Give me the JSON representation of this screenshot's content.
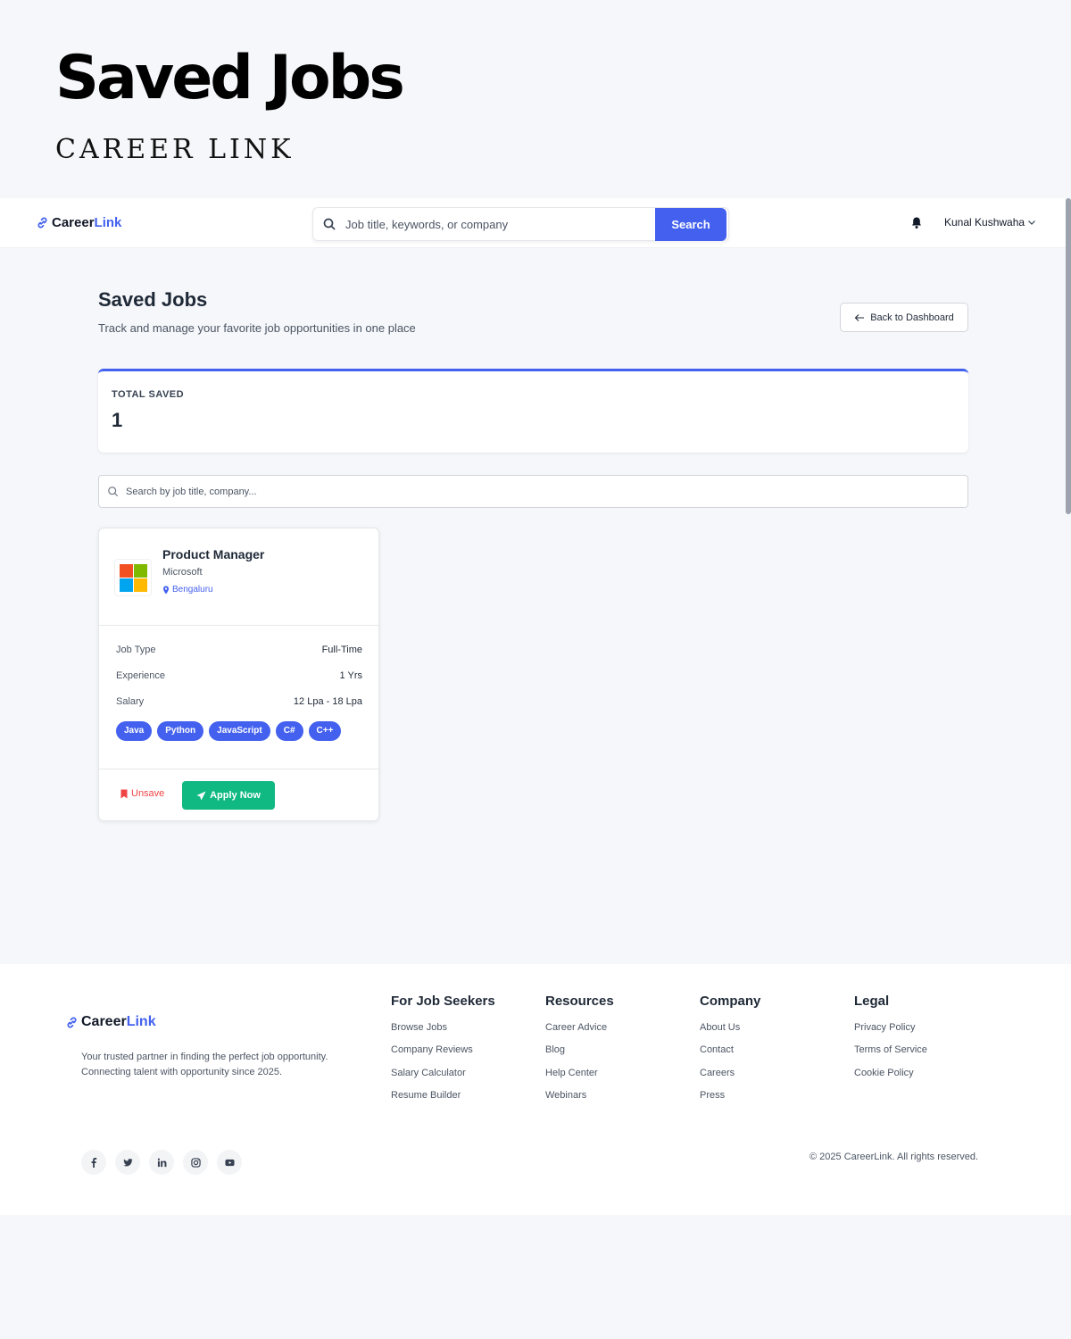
{
  "hero": {
    "title": "Saved Jobs",
    "subtitle": "CAREER LINK"
  },
  "brand": {
    "part1": "Career",
    "part2": "Link",
    "accent": "#4361ee"
  },
  "nav": {
    "search_placeholder": "Job title, keywords, or company",
    "search_button": "Search",
    "user_name": "Kunal Kushwaha",
    "icons": [
      "search-icon",
      "bell-icon",
      "chevron-down-icon"
    ]
  },
  "header": {
    "title": "Saved Jobs",
    "subtitle": "Track and manage your favorite job opportunities in one place",
    "back_button": "Back to Dashboard"
  },
  "stats": {
    "label": "TOTAL SAVED",
    "value": "1"
  },
  "filter": {
    "placeholder": "Search by job title, company..."
  },
  "jobs": [
    {
      "title": "Product Manager",
      "company": "Microsoft",
      "location": "Bengaluru",
      "details": [
        {
          "label": "Job Type",
          "value": "Full-Time"
        },
        {
          "label": "Experience",
          "value": "1 Yrs"
        },
        {
          "label": "Salary",
          "value": "12 Lpa - 18 Lpa"
        }
      ],
      "skills": [
        "Java",
        "Python",
        "JavaScript",
        "C#",
        "C++"
      ],
      "unsave_label": "Unsave",
      "apply_label": "Apply Now"
    }
  ],
  "footer": {
    "description": "Your trusted partner in finding the perfect job opportunity. Connecting talent with opportunity since 2025.",
    "columns": [
      {
        "heading": "For Job Seekers",
        "links": [
          "Browse Jobs",
          "Company Reviews",
          "Salary Calculator",
          "Resume Builder"
        ]
      },
      {
        "heading": "Resources",
        "links": [
          "Career Advice",
          "Blog",
          "Help Center",
          "Webinars"
        ]
      },
      {
        "heading": "Company",
        "links": [
          "About Us",
          "Contact",
          "Careers",
          "Press"
        ]
      },
      {
        "heading": "Legal",
        "links": [
          "Privacy Policy",
          "Terms of Service",
          "Cookie Policy"
        ]
      }
    ],
    "socials": [
      "facebook-icon",
      "twitter-icon",
      "linkedin-icon",
      "instagram-icon",
      "youtube-icon"
    ],
    "copyright": "© 2025 CareerLink. All rights reserved."
  },
  "colors": {
    "primary": "#4361ee",
    "success": "#10b981",
    "danger": "#ef4444"
  }
}
